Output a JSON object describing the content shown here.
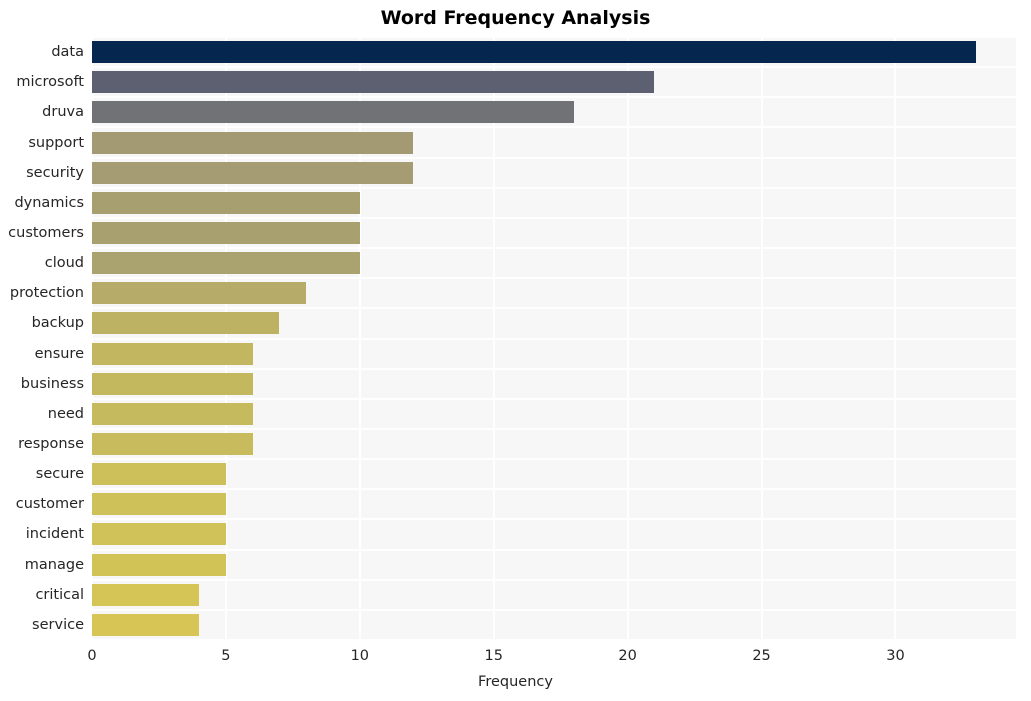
{
  "chart_data": {
    "type": "bar",
    "orientation": "horizontal",
    "title": "Word Frequency Analysis",
    "xlabel": "Frequency",
    "ylabel": "",
    "categories": [
      "data",
      "microsoft",
      "druva",
      "support",
      "security",
      "dynamics",
      "customers",
      "cloud",
      "protection",
      "backup",
      "ensure",
      "business",
      "need",
      "response",
      "secure",
      "customer",
      "incident",
      "manage",
      "critical",
      "service"
    ],
    "values": [
      33,
      21,
      18,
      12,
      12,
      10,
      10,
      10,
      8,
      7,
      6,
      6,
      6,
      6,
      5,
      5,
      5,
      5,
      4,
      4
    ],
    "bar_colors": [
      "#04264f",
      "#5c6070",
      "#717276",
      "#a39a74",
      "#a59c73",
      "#a89f71",
      "#a9a070",
      "#aaa26f",
      "#b6ab68",
      "#bdb164",
      "#c2b660",
      "#c4b85f",
      "#c6ba5e",
      "#c8bb5d",
      "#cdbf5a",
      "#cfc159",
      "#d0c258",
      "#d2c357",
      "#d5c556",
      "#d7c555"
    ],
    "xlim": [
      0,
      34.5
    ],
    "xticks": [
      0,
      5,
      10,
      15,
      20,
      25,
      30
    ],
    "xtick_labels": [
      "0",
      "5",
      "10",
      "15",
      "20",
      "25",
      "30"
    ],
    "grid": true,
    "grid_color": "#ffffff",
    "plot_background": "#f7f7f7",
    "figure_background": "#ffffff",
    "legend": null
  }
}
